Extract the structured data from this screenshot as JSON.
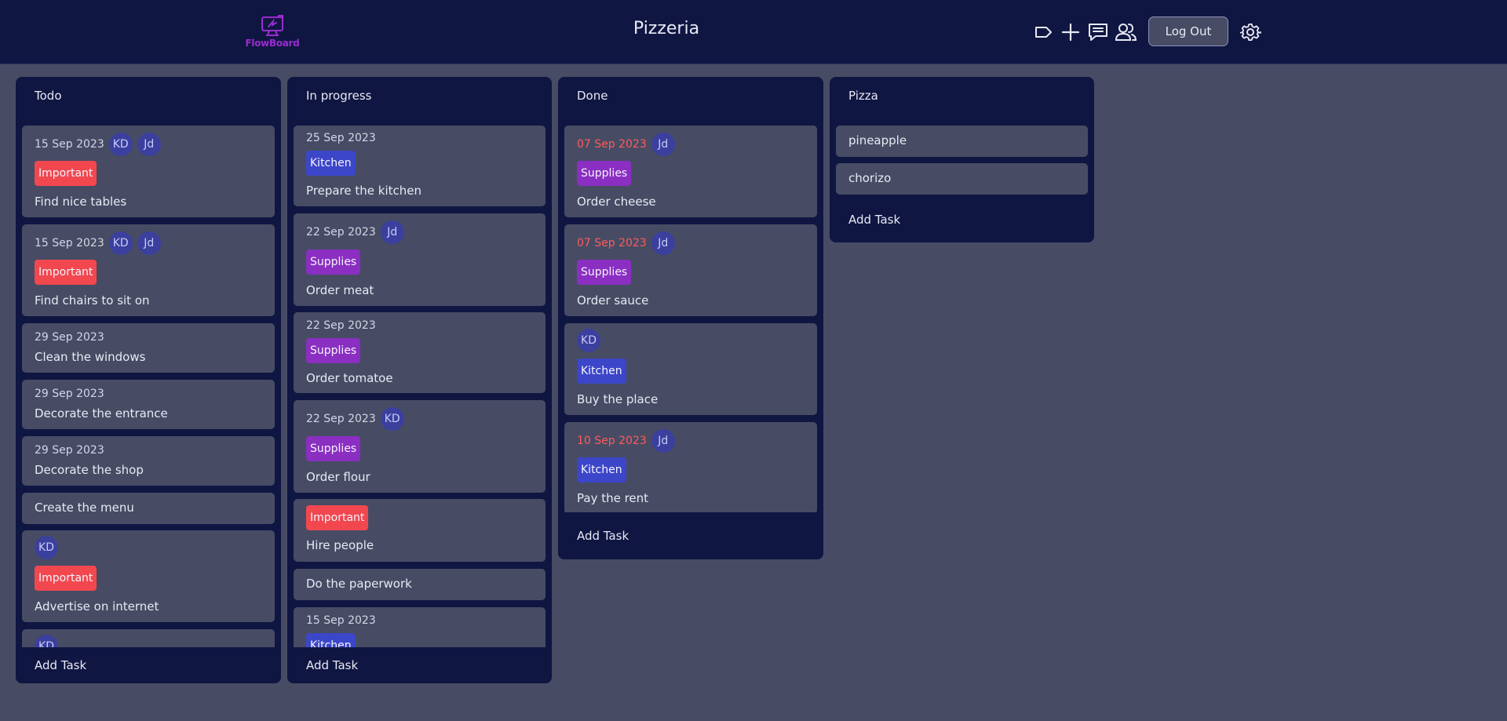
{
  "header": {
    "logo_text": "FlowBoard",
    "board_title": "Pizzeria",
    "logout_label": "Log Out",
    "accent": "#0f1642"
  },
  "columns": [
    {
      "title": "Todo",
      "add_label": "Add Task",
      "tasks": [
        {
          "date": "15 Sep 2023",
          "avatars": [
            "KD",
            "Jd"
          ],
          "tag": "Important",
          "title": "Find nice tables"
        },
        {
          "date": "15 Sep 2023",
          "avatars": [
            "KD",
            "Jd"
          ],
          "tag": "Important",
          "title": "Find chairs to sit on"
        },
        {
          "date": "29 Sep 2023",
          "title": "Clean the windows"
        },
        {
          "date": "29 Sep 2023",
          "title": "Decorate the entrance"
        },
        {
          "date": "29 Sep 2023",
          "title": "Decorate the shop"
        },
        {
          "title": "Create the menu"
        },
        {
          "avatars": [
            "KD"
          ],
          "tag": "Important",
          "title": "Advertise on internet"
        },
        {
          "avatars": [
            "KD"
          ]
        }
      ]
    },
    {
      "title": "In progress",
      "add_label": "Add Task",
      "tasks": [
        {
          "date": "25 Sep 2023",
          "tag": "Kitchen",
          "title": "Prepare the kitchen"
        },
        {
          "date": "22 Sep 2023",
          "avatars": [
            "Jd"
          ],
          "tag": "Supplies",
          "title": "Order meat"
        },
        {
          "date": "22 Sep 2023",
          "tag": "Supplies",
          "title": "Order tomatoe"
        },
        {
          "date": "22 Sep 2023",
          "avatars": [
            "KD"
          ],
          "tag": "Supplies",
          "title": "Order flour"
        },
        {
          "tag": "Important",
          "title": "Hire people"
        },
        {
          "title": "Do the paperwork"
        },
        {
          "date": "15 Sep 2023",
          "tag": "Kitchen"
        }
      ]
    },
    {
      "title": "Done",
      "add_label": "Add Task",
      "tasks": [
        {
          "date": "07 Sep 2023",
          "overdue": true,
          "avatars": [
            "Jd"
          ],
          "tag": "Supplies",
          "title": "Order cheese"
        },
        {
          "date": "07 Sep 2023",
          "overdue": true,
          "avatars": [
            "Jd"
          ],
          "tag": "Supplies",
          "title": "Order sauce"
        },
        {
          "avatars": [
            "KD"
          ],
          "tag": "Kitchen",
          "title": "Buy the place"
        },
        {
          "date": "10 Sep 2023",
          "overdue": true,
          "avatars": [
            "Jd"
          ],
          "tag": "Kitchen",
          "title": "Pay the rent"
        }
      ]
    },
    {
      "title": "Pizza",
      "add_label": "Add Task",
      "tasks": [
        {
          "title": "pineapple"
        },
        {
          "title": "chorizo"
        }
      ]
    }
  ],
  "tag_colors": {
    "Important": "#f2474f",
    "Supplies": "#8b2ec2",
    "Kitchen": "#3c46c9"
  },
  "icons": {
    "label": "tag-icon",
    "add": "plus-icon",
    "comments": "message-icon",
    "members": "users-icon",
    "settings": "gear-icon"
  }
}
